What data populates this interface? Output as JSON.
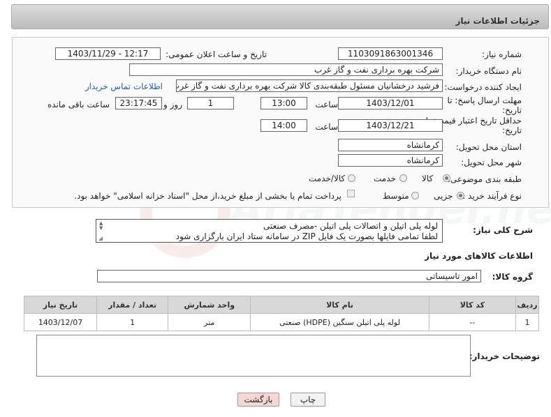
{
  "header": {
    "title": "جزئیات اطلاعات نیاز"
  },
  "need_number": {
    "label": "شماره نیاز:",
    "value": "1103091863001346"
  },
  "announce": {
    "label": "تاریخ و ساعت اعلان عمومی:",
    "value": "1403/11/29 - 12:17"
  },
  "buyer": {
    "label": "نام دستگاه خریدار:",
    "value": "شرکت بهره برداری نفت و گاز غرب"
  },
  "creator": {
    "label": "ایجاد کننده درخواست:",
    "value": "فرشید درخشانیان مسئول طبقه‌بندی کالا شرکت بهره برداری نفت و گاز غرب",
    "contact_link": "اطلاعات تماس خریدار"
  },
  "reply_deadline": {
    "label_line1": "مهلت ارسال پاسخ: تا",
    "label_line2": "تاریخ:",
    "date": "1403/12/01",
    "time_label": "ساعت",
    "time": "13:00",
    "days": "1",
    "days_label": "روز و",
    "remaining": "23:17:45",
    "remaining_label": "ساعت باقی مانده"
  },
  "price_validity": {
    "label_line1": "حداقل تاریخ اعتبار قیمت: تا",
    "label_line2": "تاریخ:",
    "date": "1403/12/21",
    "time_label": "ساعت",
    "time": "14:00"
  },
  "province": {
    "label": "استان محل تحویل:",
    "value": "کرمانشاه"
  },
  "city": {
    "label": "شهر محل تحویل:",
    "value": "کرمانشاه"
  },
  "category": {
    "label": "طبقه بندی موضوعی:",
    "options": [
      "کالا",
      "خدمت",
      "کالا/خدمت"
    ],
    "selected": "کالا"
  },
  "purchase_type": {
    "label": "نوع فرآیند خرید :",
    "options": [
      "جزیی",
      "متوسط"
    ],
    "selected": "جزیی",
    "payment_note": "پرداخت تمام یا بخشی از مبلغ خرید،از محل \"اسناد خزانه اسلامی\" خواهد بود."
  },
  "description": {
    "label": "شرح کلی نیاز:",
    "line1": "لوله پلی اتیلن و اتصالات پلی اتیلن -مصرف صنعتی",
    "line2": "لطفا تمامی فایلها بصورت یک فایل ZIP در سامانه ستاد ایران بارگزاری شود"
  },
  "goods_section": {
    "title": "اطلاعات کالاهای مورد نیاز",
    "group_label": "گروه کالا:",
    "group_value": "امور تاسیساتی"
  },
  "table": {
    "headers": [
      "ردیف",
      "کد کالا",
      "نام کالا",
      "واحد شمارش",
      "تعداد / مقدار",
      "تاریخ نیاز"
    ],
    "rows": [
      [
        "1",
        "--",
        "لوله پلی اتیلن سنگین (HDPE) صنعتی",
        "متر",
        "1",
        "1403/12/07"
      ]
    ]
  },
  "notes": {
    "label": "توضیحات خریدار:",
    "value": ""
  },
  "buttons": {
    "print": "چاپ",
    "back": "بازگشت"
  },
  "watermark": {
    "text": "AriaTender.neT"
  },
  "colors": {
    "header_bg": "#c8c8c8",
    "link": "#1f5fb8",
    "back_button_bg": "#f5d7d7",
    "panel_border": "#c8c8c8"
  }
}
